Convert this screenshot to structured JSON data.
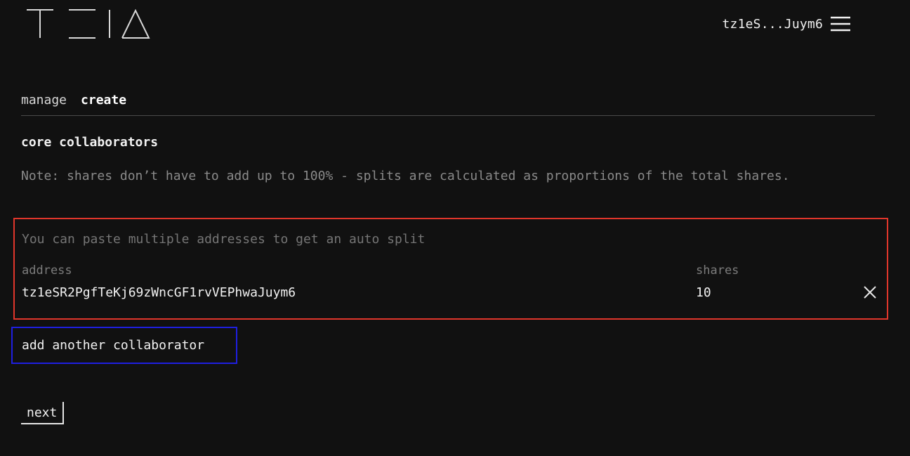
{
  "header": {
    "logo_name": "teia-logo",
    "wallet_address": "tz1eS...Juym6",
    "menu_icon": "hamburger-menu-icon"
  },
  "tabs": [
    {
      "label": "manage",
      "active": false
    },
    {
      "label": "create",
      "active": true
    }
  ],
  "section": {
    "title": "core collaborators",
    "note": "Note: shares don’t have to add up to 100% - splits are calculated as proportions of the total shares."
  },
  "collaborators": {
    "paste_placeholder": "You can paste multiple addresses to get an auto split",
    "address_label": "address",
    "shares_label": "shares",
    "rows": [
      {
        "address": "tz1eSR2PgfTeKj69zWncGF1rvVEPhwaJuym6",
        "shares": "10"
      }
    ],
    "remove_icon": "close-icon"
  },
  "actions": {
    "add_label": "add another collaborator",
    "next_label": "next"
  },
  "colors": {
    "background": "#111111",
    "highlight_red": "#e0362b",
    "highlight_blue": "#1f1fe0",
    "muted_text": "#8a8a8a"
  }
}
